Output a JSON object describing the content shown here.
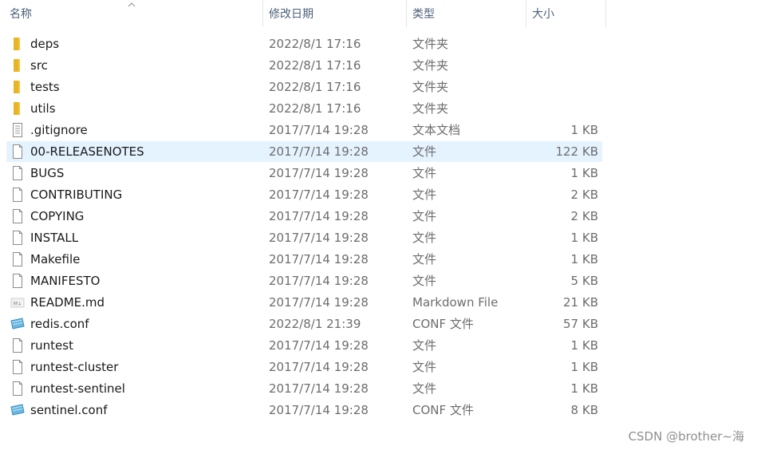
{
  "columns": {
    "name": "名称",
    "modified": "修改日期",
    "type": "类型",
    "size": "大小"
  },
  "files": [
    {
      "name": "deps",
      "modified": "2022/8/1 17:16",
      "type": "文件夹",
      "size": "",
      "icon": "folder-icon"
    },
    {
      "name": "src",
      "modified": "2022/8/1 17:16",
      "type": "文件夹",
      "size": "",
      "icon": "folder-icon"
    },
    {
      "name": "tests",
      "modified": "2022/8/1 17:16",
      "type": "文件夹",
      "size": "",
      "icon": "folder-icon"
    },
    {
      "name": "utils",
      "modified": "2022/8/1 17:16",
      "type": "文件夹",
      "size": "",
      "icon": "folder-icon"
    },
    {
      "name": ".gitignore",
      "modified": "2017/7/14 19:28",
      "type": "文本文档",
      "size": "1 KB",
      "icon": "text-document-icon"
    },
    {
      "name": "00-RELEASENOTES",
      "modified": "2017/7/14 19:28",
      "type": "文件",
      "size": "122 KB",
      "icon": "file-icon",
      "selected": true
    },
    {
      "name": "BUGS",
      "modified": "2017/7/14 19:28",
      "type": "文件",
      "size": "1 KB",
      "icon": "file-icon"
    },
    {
      "name": "CONTRIBUTING",
      "modified": "2017/7/14 19:28",
      "type": "文件",
      "size": "2 KB",
      "icon": "file-icon"
    },
    {
      "name": "COPYING",
      "modified": "2017/7/14 19:28",
      "type": "文件",
      "size": "2 KB",
      "icon": "file-icon"
    },
    {
      "name": "INSTALL",
      "modified": "2017/7/14 19:28",
      "type": "文件",
      "size": "1 KB",
      "icon": "file-icon"
    },
    {
      "name": "Makefile",
      "modified": "2017/7/14 19:28",
      "type": "文件",
      "size": "1 KB",
      "icon": "file-icon"
    },
    {
      "name": "MANIFESTO",
      "modified": "2017/7/14 19:28",
      "type": "文件",
      "size": "5 KB",
      "icon": "file-icon"
    },
    {
      "name": "README.md",
      "modified": "2017/7/14 19:28",
      "type": "Markdown File",
      "size": "21 KB",
      "icon": "markdown-file-icon"
    },
    {
      "name": "redis.conf",
      "modified": "2022/8/1 21:39",
      "type": "CONF 文件",
      "size": "57 KB",
      "icon": "conf-file-icon"
    },
    {
      "name": "runtest",
      "modified": "2017/7/14 19:28",
      "type": "文件",
      "size": "1 KB",
      "icon": "file-icon"
    },
    {
      "name": "runtest-cluster",
      "modified": "2017/7/14 19:28",
      "type": "文件",
      "size": "1 KB",
      "icon": "file-icon"
    },
    {
      "name": "runtest-sentinel",
      "modified": "2017/7/14 19:28",
      "type": "文件",
      "size": "1 KB",
      "icon": "file-icon"
    },
    {
      "name": "sentinel.conf",
      "modified": "2017/7/14 19:28",
      "type": "CONF 文件",
      "size": "8 KB",
      "icon": "conf-file-icon"
    }
  ],
  "watermark": "CSDN @brother~海",
  "colors": {
    "folder": "#f4c542",
    "selected_row": "#e5f3ff",
    "header_text": "#4c607a"
  }
}
